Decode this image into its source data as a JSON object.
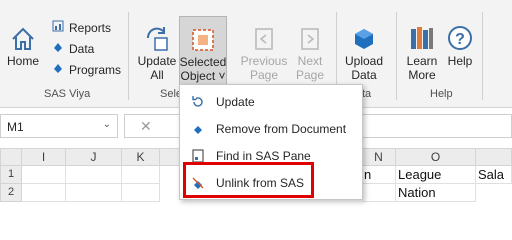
{
  "ribbon": {
    "sas_viya": {
      "home": "Home",
      "reports": "Reports",
      "data": "Data",
      "programs": "Programs",
      "group_label": "SAS Viya"
    },
    "selection": {
      "update_all": [
        "Update",
        "All"
      ],
      "selected_object": [
        "Selected",
        "Object ˅"
      ],
      "group_label": "Sele"
    },
    "nav": {
      "previous_page": [
        "Previous",
        "Page"
      ],
      "next_page": [
        "Next",
        "Page"
      ]
    },
    "data_group": {
      "upload_data": [
        "Upload",
        "Data"
      ],
      "group_label": "ta"
    },
    "help": {
      "learn_more": [
        "Learn",
        "More"
      ],
      "help": "Help",
      "group_label": "Help"
    }
  },
  "formula_bar": {
    "name_box": "M1",
    "cancel_symbol": "✕"
  },
  "grid": {
    "columns": [
      "I",
      "J",
      "K",
      "N",
      "O"
    ],
    "rows": [
      "1",
      "2"
    ],
    "row1_cells": {
      "N": "n",
      "O": "League",
      "P": "Sala"
    },
    "row2_cells": {
      "O": "Nation"
    }
  },
  "menu": {
    "items": [
      "Update",
      "Remove from Document",
      "Find in SAS Pane",
      "Unlink from SAS"
    ]
  },
  "colors": {
    "highlight": "#e00000",
    "ribbon_bg": "#f3f3f3",
    "sas_blue": "#1f6fbf"
  }
}
